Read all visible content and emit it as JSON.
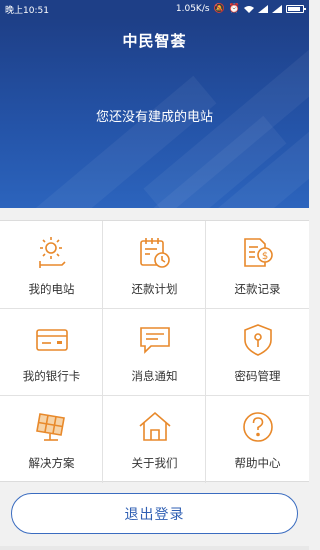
{
  "status_bar": {
    "time": "晚上10:51",
    "speed": "1.05K/s"
  },
  "header": {
    "title": "中民智荟",
    "empty_message": "您还没有建成的电站"
  },
  "menu": {
    "items": [
      {
        "label": "我的电站",
        "icon": "solar-sun-icon"
      },
      {
        "label": "还款计划",
        "icon": "calendar-clock-icon"
      },
      {
        "label": "还款记录",
        "icon": "document-dollar-icon"
      },
      {
        "label": "我的银行卡",
        "icon": "bank-card-icon"
      },
      {
        "label": "消息通知",
        "icon": "message-icon"
      },
      {
        "label": "密码管理",
        "icon": "shield-key-icon"
      },
      {
        "label": "解决方案",
        "icon": "solar-panel-icon"
      },
      {
        "label": "关于我们",
        "icon": "house-icon"
      },
      {
        "label": "帮助中心",
        "icon": "question-icon"
      }
    ]
  },
  "logout_label": "退出登录",
  "colors": {
    "header_blue": "#1e3f87",
    "icon_orange": "#e8892b",
    "button_blue": "#2f5fb3"
  }
}
